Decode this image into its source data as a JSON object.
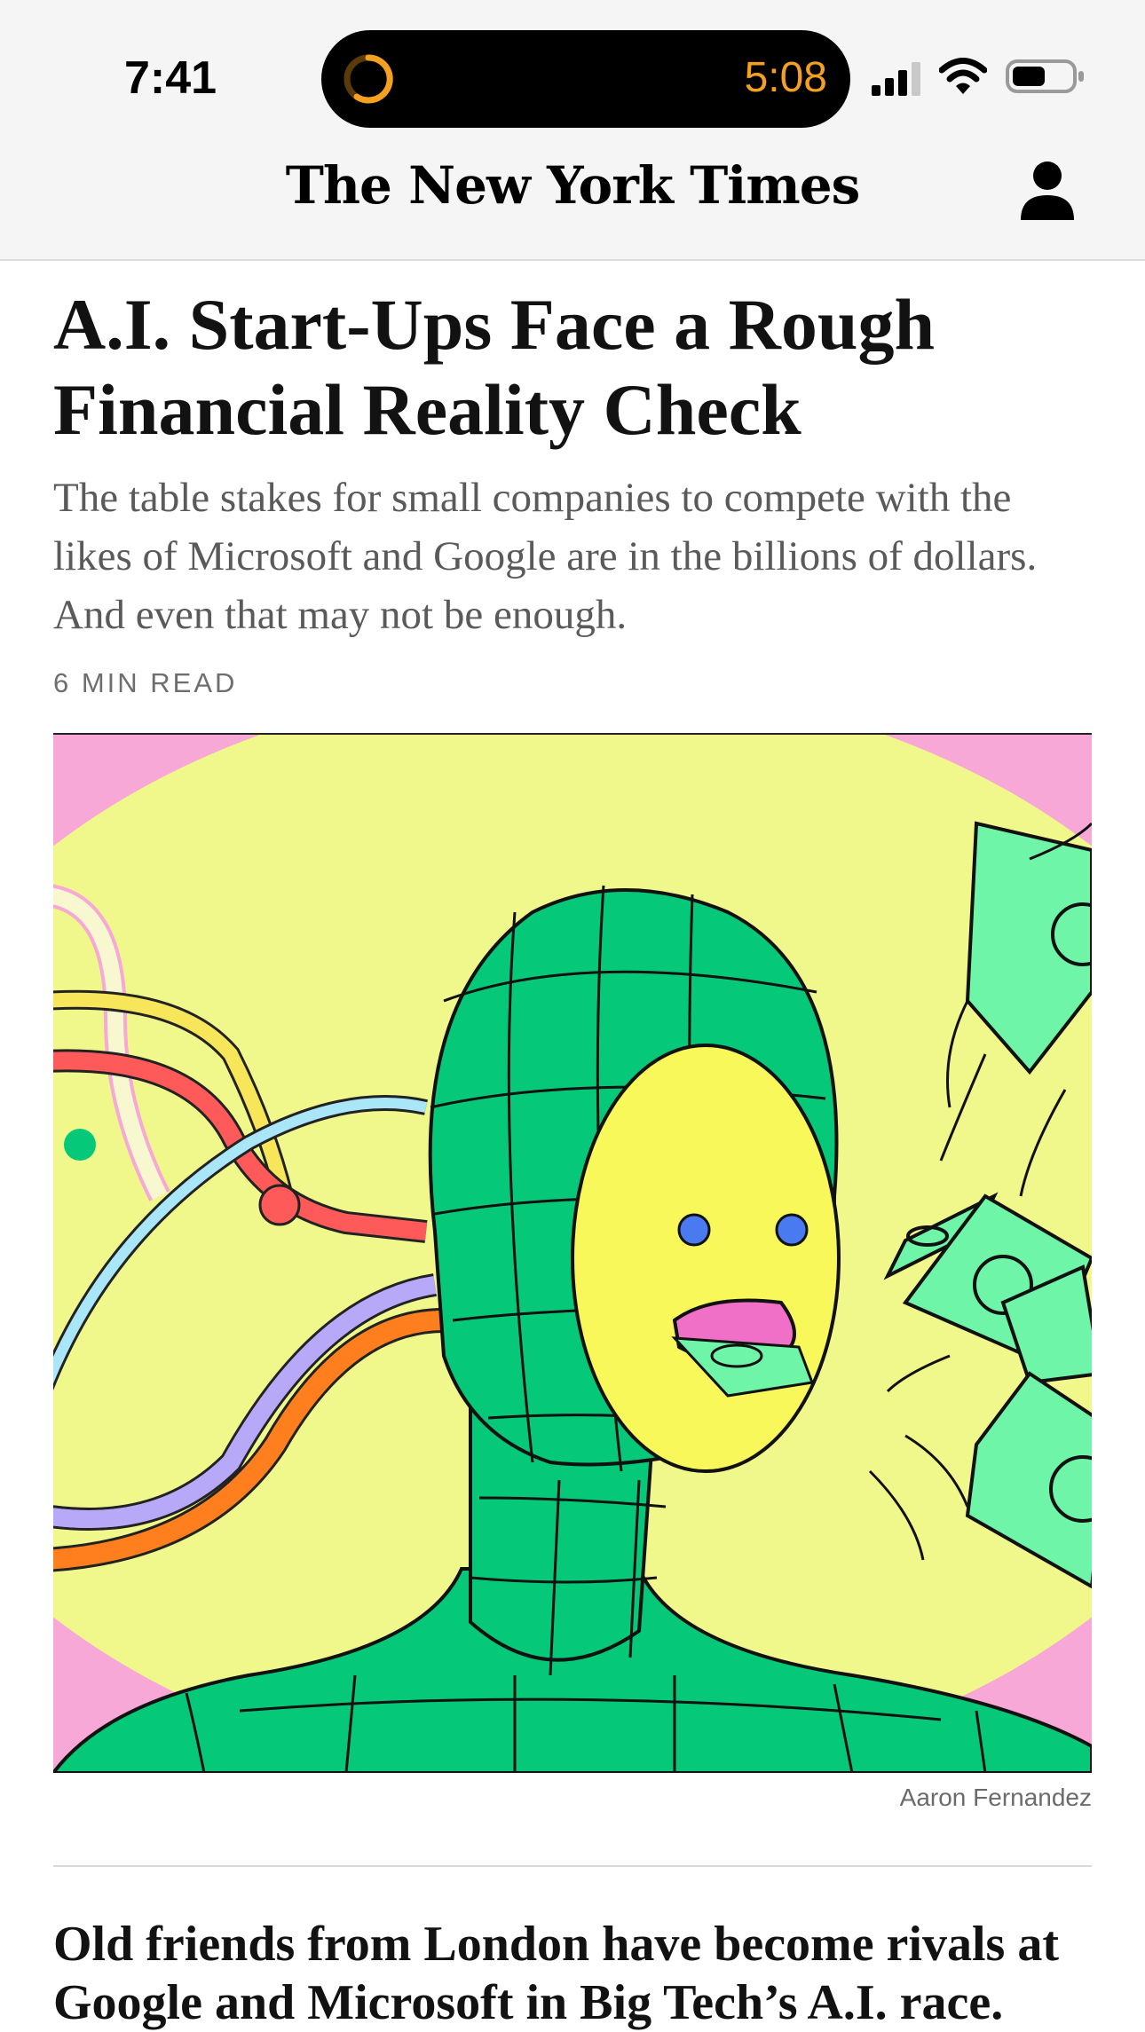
{
  "status_bar": {
    "time": "7:41",
    "island_timer": "5:08",
    "icons": [
      "timer-ring-icon",
      "cellular-signal-icon",
      "wifi-icon",
      "battery-icon"
    ]
  },
  "header": {
    "masthead": "The New York Times",
    "account_icon": "person-icon"
  },
  "article": {
    "headline": "A.I. Start-Ups Face a Rough Financial Reality Check",
    "summary": "The table stakes for small companies to compete with the likes of Microsoft and Google are in the billions of dollars. And even that may not be enough.",
    "read_time": "6 MIN READ",
    "image_credit": "Aaron Fernandez"
  },
  "next_article": {
    "headline": "Old friends from London have become rivals at Google and Microsoft in Big Tech’s A.I. race."
  },
  "colors": {
    "island_timer": "#f5a020",
    "illustration_bg": "#f0f88c",
    "illustration_corner": "#f7a8d6",
    "figure_green": "#05c878",
    "face_yellow": "#f8f85a",
    "money_green": "#6ff5a8",
    "cable_red": "#ff5a5a",
    "cable_purple": "#b8a8f8",
    "cable_orange": "#ff7f1e"
  }
}
